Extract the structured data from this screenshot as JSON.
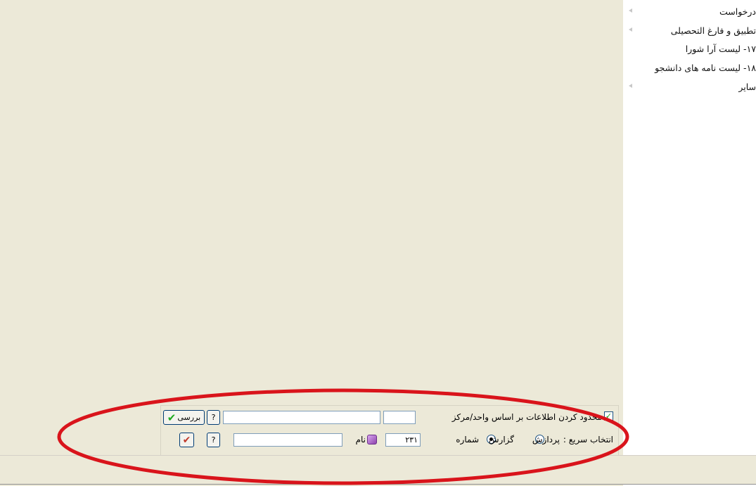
{
  "menu": {
    "items": [
      {
        "label": "درخواست"
      },
      {
        "label": "تطبیق و فارغ التحصیلی"
      },
      {
        "label": "۱۷- لیست آرا شورا"
      },
      {
        "label": "۱۸- لیست نامه های دانشجو"
      },
      {
        "label": "سایر"
      }
    ]
  },
  "filter_row": {
    "checkbox_checked": true,
    "label": "محدود کردن اطلاعات بر اساس واحد/مرکز",
    "unit_code_value": "",
    "unit_name_value": "",
    "help_label": "?",
    "review_button_label": "بررسی"
  },
  "quick_select": {
    "label": "انتخاب سریع :",
    "option_process": "پردازش",
    "option_report": "گزارش",
    "selected_option": "report",
    "number_label": "شماره",
    "number_value": "۲۳۱",
    "name_label": "نام",
    "name_value": "",
    "help_label": "?"
  },
  "annotation": {
    "ellipse_color": "#d9141b"
  }
}
